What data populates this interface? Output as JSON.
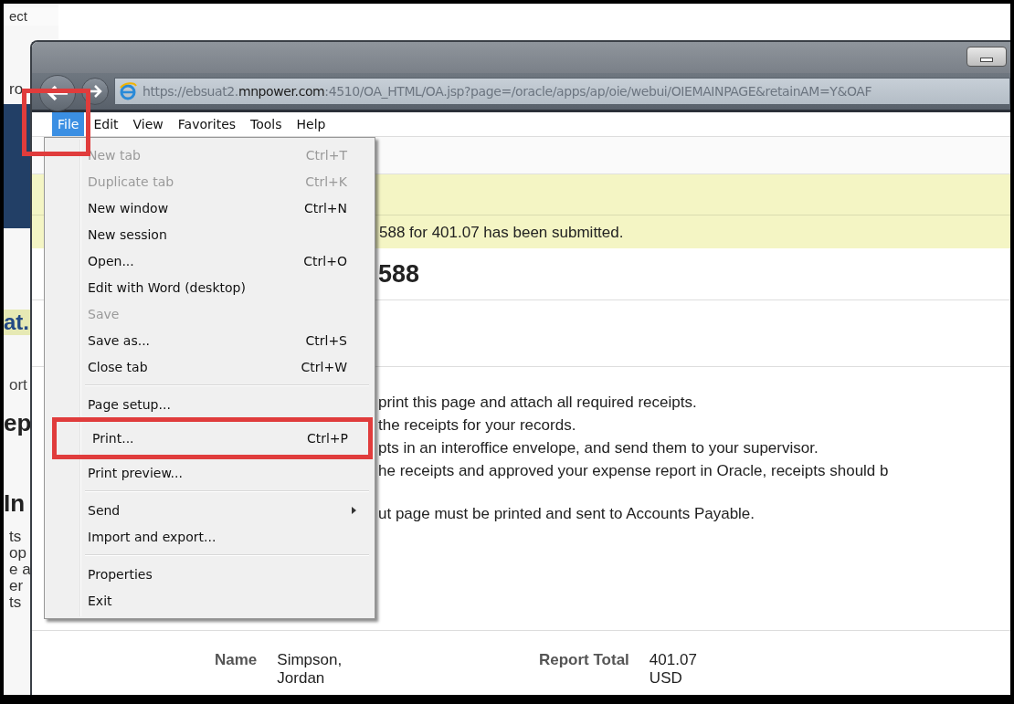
{
  "background_window": {
    "fragments": [
      {
        "kind": "plain",
        "text": "ect"
      },
      {
        "kind": "plain",
        "text": "ro"
      },
      {
        "kind": "band"
      },
      {
        "kind": "banner",
        "text": "at."
      },
      {
        "kind": "plain",
        "text": "ort"
      },
      {
        "kind": "heading",
        "text": "ep"
      },
      {
        "kind": "heading",
        "text": "In"
      },
      {
        "kind": "plain",
        "text": "ts"
      },
      {
        "kind": "plain",
        "text": "op"
      },
      {
        "kind": "plain",
        "text": "e a"
      },
      {
        "kind": "plain",
        "text": "er"
      },
      {
        "kind": "plain",
        "text": "ts"
      }
    ]
  },
  "browser": {
    "address": "https://ebsuat2.**mnpower.com**:4510/OA_HTML/OA.jsp?page=/oracle/apps/ap/oie/webui/OIEMAINPAGE&retainAM=Y&OAF",
    "menu_bar": [
      {
        "label": "File",
        "selected": true,
        "annotated": true
      },
      {
        "label": "Edit",
        "selected": false,
        "annotated": false
      },
      {
        "label": "View",
        "selected": false,
        "annotated": false
      },
      {
        "label": "Favorites",
        "selected": false,
        "annotated": false
      },
      {
        "label": "Tools",
        "selected": false,
        "annotated": false
      },
      {
        "label": "Help",
        "selected": false,
        "annotated": false
      }
    ],
    "file_menu": [
      {
        "kind": "command",
        "label": "New tab",
        "shortcut": "Ctrl+T",
        "disabled": true,
        "annotated": false,
        "submenu": false
      },
      {
        "kind": "command",
        "label": "Duplicate tab",
        "shortcut": "Ctrl+K",
        "disabled": true,
        "annotated": false,
        "submenu": false
      },
      {
        "kind": "command",
        "label": "New window",
        "shortcut": "Ctrl+N",
        "disabled": false,
        "annotated": false,
        "submenu": false
      },
      {
        "kind": "command",
        "label": "New session",
        "disabled": false,
        "annotated": false,
        "submenu": false
      },
      {
        "kind": "command",
        "label": "Open...",
        "shortcut": "Ctrl+O",
        "disabled": false,
        "annotated": false,
        "submenu": false
      },
      {
        "kind": "command",
        "label": "Edit with Word (desktop)",
        "disabled": false,
        "annotated": false,
        "submenu": false
      },
      {
        "kind": "command",
        "label": "Save",
        "disabled": true,
        "annotated": false,
        "submenu": false
      },
      {
        "kind": "command",
        "label": "Save as...",
        "shortcut": "Ctrl+S",
        "disabled": false,
        "annotated": false,
        "submenu": false
      },
      {
        "kind": "command",
        "label": "Close tab",
        "shortcut": "Ctrl+W",
        "disabled": false,
        "annotated": false,
        "submenu": false
      },
      {
        "kind": "separator"
      },
      {
        "kind": "command",
        "label": "Page setup...",
        "disabled": false,
        "annotated": false,
        "submenu": false
      },
      {
        "kind": "command",
        "label": "Print...",
        "shortcut": "Ctrl+P",
        "disabled": false,
        "annotated": true,
        "submenu": false
      },
      {
        "kind": "command",
        "label": "Print preview...",
        "disabled": false,
        "annotated": false,
        "submenu": false
      },
      {
        "kind": "separator"
      },
      {
        "kind": "command",
        "label": "Send",
        "disabled": false,
        "annotated": false,
        "submenu": true
      },
      {
        "kind": "command",
        "label": "Import and export...",
        "disabled": false,
        "annotated": false,
        "submenu": false
      },
      {
        "kind": "separator"
      },
      {
        "kind": "command",
        "label": "Properties",
        "disabled": false,
        "annotated": false,
        "submenu": false
      },
      {
        "kind": "command",
        "label": "Exit",
        "disabled": false,
        "annotated": false,
        "submenu": false
      }
    ]
  },
  "page": {
    "confirmation": "588 for 401.07 has been submitted.",
    "heading": "588",
    "instruction_paragraphs": [
      [
        "print this page and attach all required receipts.",
        "the receipts for your records.",
        "pts in an interoffice envelope, and send them to your supervisor.",
        "he receipts and approved your expense report in Oracle, receipts should b"
      ],
      [
        "ut page must be printed and sent to Accounts Payable."
      ]
    ],
    "details": [
      {
        "label": "Name",
        "value": "Simpson, Jordan"
      },
      {
        "label": "Report Total",
        "value": "401.07 USD"
      }
    ]
  }
}
